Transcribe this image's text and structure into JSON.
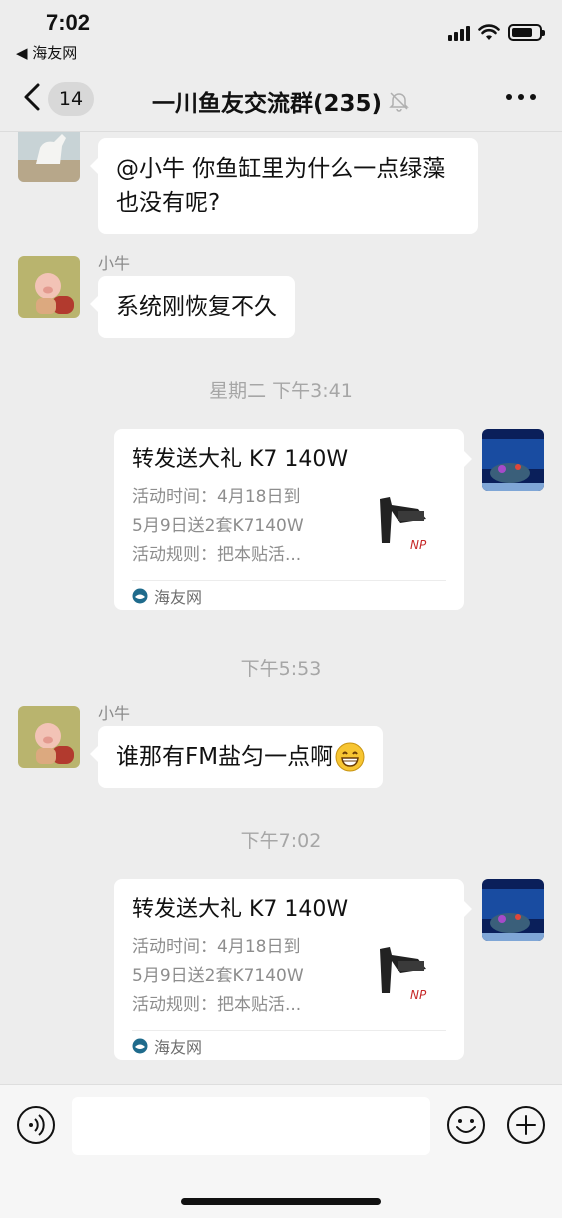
{
  "status_bar": {
    "time": "7:02",
    "back_app": "◀ 海友网"
  },
  "nav": {
    "unread_count": "14",
    "title": "一川鱼友交流群(235)",
    "muted": true
  },
  "messages": [
    {
      "type": "text",
      "side": "left",
      "avatar": "horse-avatar",
      "text": "@小牛 你鱼缸里为什么一点绿藻也没有呢?"
    },
    {
      "type": "text",
      "side": "left",
      "avatar": "pig-avatar",
      "sender": "小牛",
      "text": "系统刚恢复不久"
    },
    {
      "type": "timestamp",
      "text": "星期二 下午3:41"
    },
    {
      "type": "link_card",
      "side": "right",
      "avatar": "aquarium-avatar",
      "title": "转发送大礼 K7 140W",
      "desc_lines": [
        "活动时间：4月18日到",
        "5月9日送2套K7140W",
        "活动规则：把本贴活..."
      ],
      "source": "海友网"
    },
    {
      "type": "timestamp",
      "text": "下午5:53"
    },
    {
      "type": "text",
      "side": "left",
      "avatar": "pig-avatar",
      "sender": "小牛",
      "text": "谁那有FM盐匀一点啊"
    },
    {
      "type": "timestamp",
      "text": "下午7:02"
    },
    {
      "type": "link_card",
      "side": "right",
      "avatar": "aquarium-avatar",
      "title": "转发送大礼 K7 140W",
      "desc_lines": [
        "活动时间：4月18日到",
        "5月9日送2套K7140W",
        "活动规则：把本贴活..."
      ],
      "source": "海友网"
    }
  ],
  "input_bar": {
    "placeholder": ""
  },
  "colors": {
    "background": "#ededed",
    "bubble": "#ffffff",
    "timestamp": "#a6a6a6",
    "accent_logo": "#c62828"
  }
}
